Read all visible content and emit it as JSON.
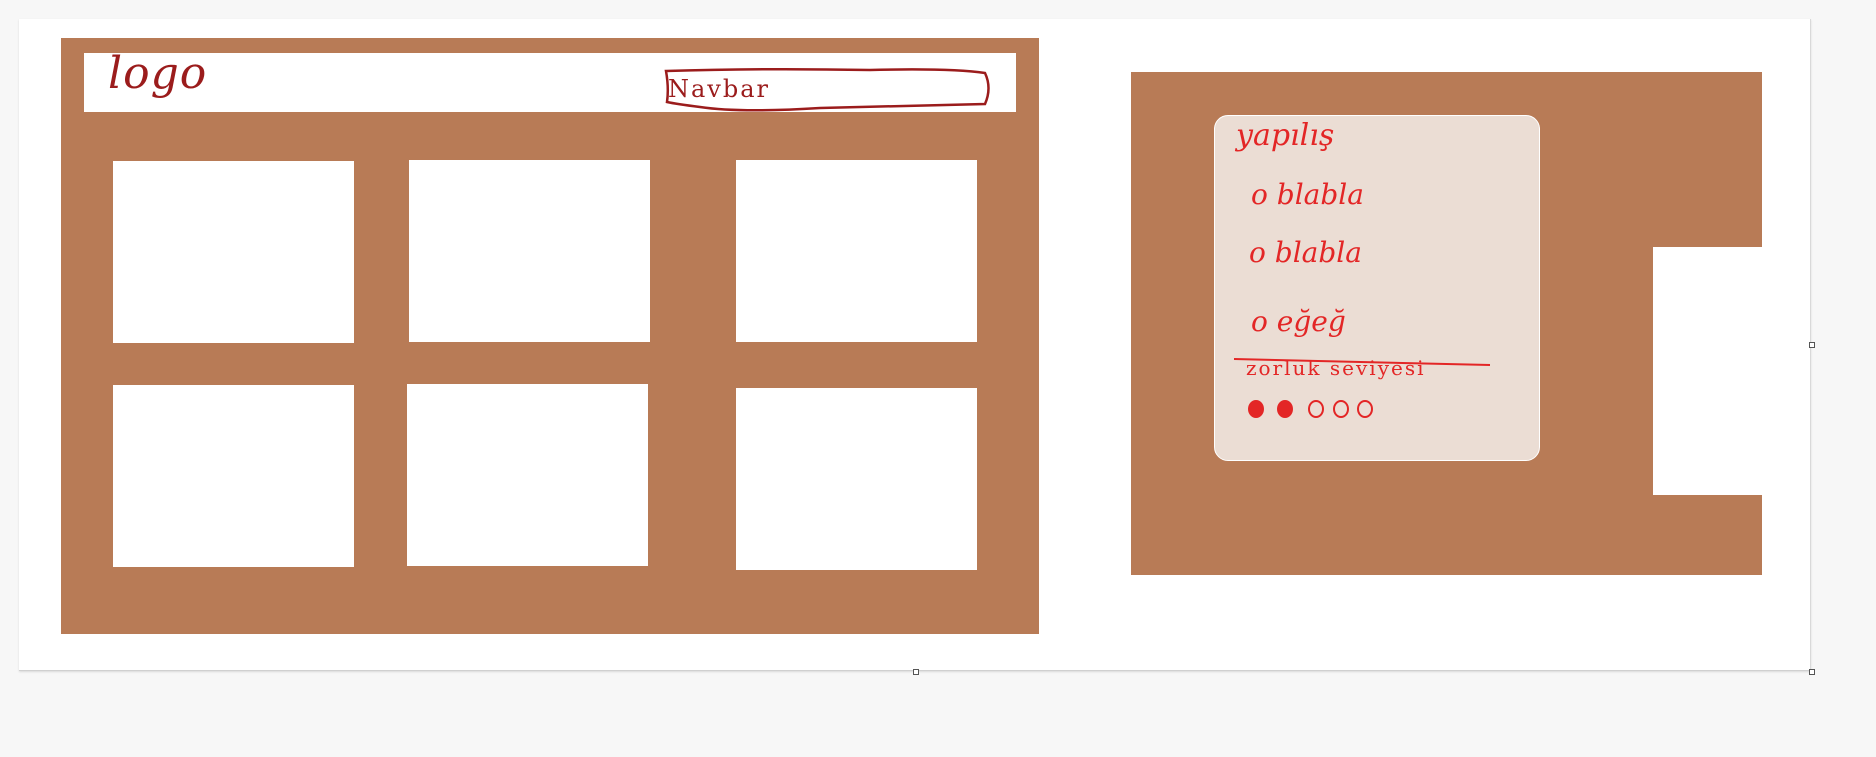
{
  "left_wireframe": {
    "logo_text": "logo",
    "navbar_text": "Navbar",
    "tile_count": 6
  },
  "right_wireframe": {
    "card": {
      "title": "yapılış",
      "items": [
        "blabla",
        "blabla",
        "eğeğ"
      ],
      "difficulty_label": "zorluk seviyesi",
      "difficulty": {
        "filled": 2,
        "total": 5
      }
    }
  },
  "colors": {
    "wireframe_fill": "#b87b56",
    "card_fill": "#ebddd4",
    "left_ink": "#9b1c1c",
    "right_ink": "#e32626"
  }
}
